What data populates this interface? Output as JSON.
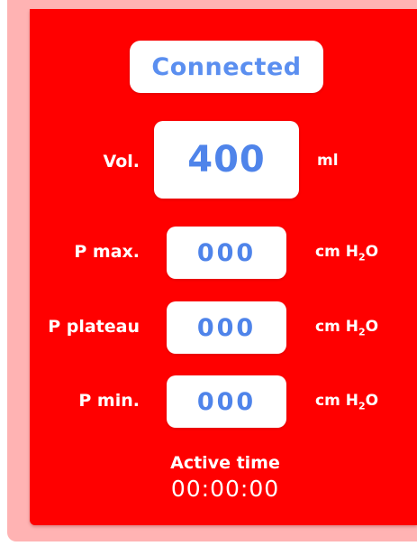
{
  "colors": {
    "panel": "#ff0000",
    "shadow_panel": "#ffb3b3",
    "box": "#ffffff",
    "value_text": "#4f84ea",
    "status_text": "#5b8ff0",
    "label_text": "#ffffff"
  },
  "status": {
    "label": "Connected"
  },
  "volume": {
    "label": "Vol.",
    "value": "400",
    "unit": "ml"
  },
  "pressures": [
    {
      "label": "P max.",
      "value": "000",
      "unit_main": "cm H",
      "unit_sub": "2",
      "unit_tail": "O"
    },
    {
      "label": "P plateau",
      "value": "000",
      "unit_main": "cm H",
      "unit_sub": "2",
      "unit_tail": "O"
    },
    {
      "label": "P min.",
      "value": "000",
      "unit_main": "cm H",
      "unit_sub": "2",
      "unit_tail": "O"
    }
  ],
  "timer": {
    "label": "Active time",
    "value": "00:00:00"
  }
}
